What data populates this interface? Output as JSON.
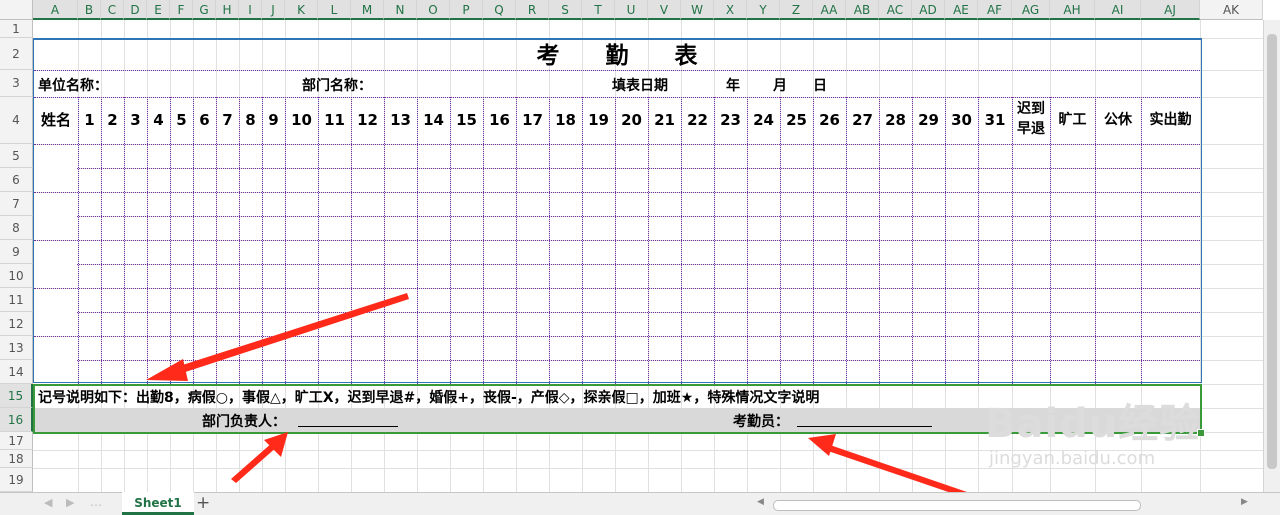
{
  "columns": [
    "A",
    "B",
    "C",
    "D",
    "E",
    "F",
    "G",
    "H",
    "I",
    "J",
    "K",
    "L",
    "M",
    "N",
    "O",
    "P",
    "Q",
    "R",
    "S",
    "T",
    "U",
    "V",
    "W",
    "X",
    "Y",
    "Z",
    "AA",
    "AB",
    "AC",
    "AD",
    "AE",
    "AF",
    "AG",
    "AH",
    "AI",
    "AJ",
    "AK"
  ],
  "rows": [
    "1",
    "2",
    "3",
    "4",
    "5",
    "6",
    "7",
    "8",
    "9",
    "10",
    "11",
    "12",
    "13",
    "14",
    "15",
    "16",
    "17",
    "18",
    "19"
  ],
  "sheet": {
    "title": "考　　勤　　表",
    "unit_label": "单位名称：",
    "dept_label": "部门名称：",
    "fill_date_label": "填表日期",
    "year_label": "年",
    "month_label": "月",
    "day_label": "日",
    "name_header": "姓名",
    "days": [
      "1",
      "2",
      "3",
      "4",
      "5",
      "6",
      "7",
      "8",
      "9",
      "10",
      "11",
      "12",
      "13",
      "14",
      "15",
      "16",
      "17",
      "18",
      "19",
      "20",
      "21",
      "22",
      "23",
      "24",
      "25",
      "26",
      "27",
      "28",
      "29",
      "30",
      "31"
    ],
    "late_header_line1": "迟到",
    "late_header_line2": "早退",
    "absent_header": "旷工",
    "official_leave_header": "公休",
    "actual_attendance_header": "实出勤",
    "legend": "记号说明如下：出勤8，病假○，事假△，旷工X，迟到早退#，婚假+，丧假-，产假◇，探亲假□，加班★，特殊情况文字说明",
    "dept_head_label": "部门负责人：",
    "attendance_clerk_label": "考勤员："
  },
  "tabs": {
    "sheet1": "Sheet1",
    "add": "+"
  },
  "watermark": {
    "brand": "Baidu经验",
    "url": "jingyan.baidu.com"
  },
  "colors": {
    "accent": "#217346",
    "annotation": "#ff2a1a",
    "dotted": "#7030a0",
    "table_border": "#2e75b6"
  }
}
